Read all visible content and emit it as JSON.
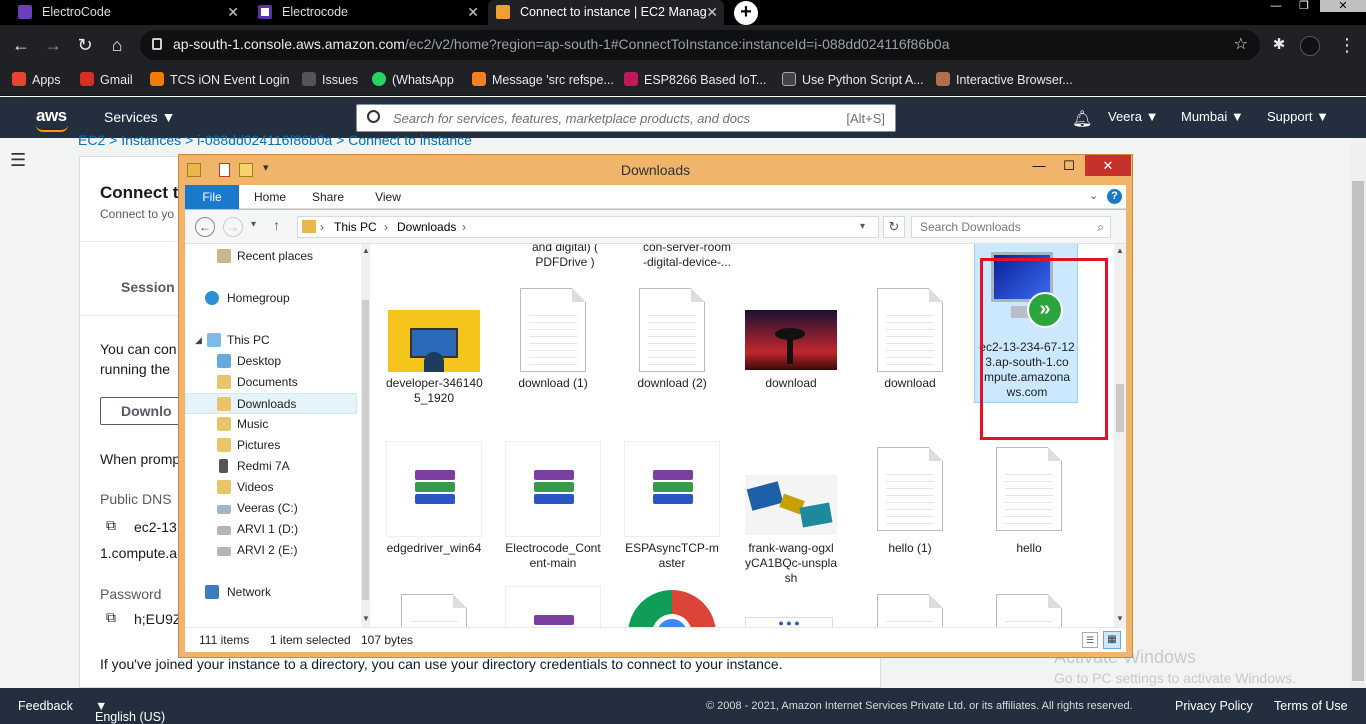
{
  "browser": {
    "tabs": [
      {
        "title": "ElectroCode",
        "color": "#6c3fbf"
      },
      {
        "title": "Electrocode",
        "color": "#ffffff"
      },
      {
        "title": "Connect to instance | EC2 Manag",
        "color": "#f0a030",
        "active": true
      }
    ],
    "new_tab": "+",
    "url_host": "ap-south-1.console.aws.amazon.com",
    "url_path": "/ec2/v2/home?region=ap-south-1#ConnectToInstance:instanceId=i-088dd024116f86b0a",
    "bookmarks": [
      {
        "label": "Apps",
        "color": "#ea4335"
      },
      {
        "label": "Gmail",
        "color": "#d93025"
      },
      {
        "label": "TCS iON Event Login",
        "color": "#f57c00"
      },
      {
        "label": "Issues",
        "color": "#555555"
      },
      {
        "label": "(WhatsApp",
        "color": "#25d366"
      },
      {
        "label": "Message 'src refspe...",
        "color": "#f48024"
      },
      {
        "label": "ESP8266 Based IoT...",
        "color": "#c2185b"
      },
      {
        "label": "Use Python Script A...",
        "color": "#444444"
      },
      {
        "label": "Interactive Browser...",
        "color": "#b07050"
      }
    ]
  },
  "aws": {
    "logo": "aws",
    "services": "Services",
    "search_placeholder": "Search for services, features, marketplace products, and docs",
    "search_shortcut": "[Alt+S]",
    "user": "Veera",
    "region": "Mumbai",
    "support": "Support",
    "breadcrumb": "EC2   >   Instances   >   i-088dd024116f86b0a   >   Connect to instance",
    "page_title": "Connect t",
    "page_subtitle": "Connect to yo",
    "session_label": "Session M",
    "body_line1": "You can con",
    "body_line2": "running the",
    "download_btn": "Downlo",
    "when_prompt": "When promp",
    "public_dns_label": "Public DNS",
    "public_dns_value1": "ec2-13",
    "public_dns_value2": "1.compute.a",
    "password_label": "Password",
    "password_value": "h;EU9Z",
    "joined_text": "If you've joined your instance to a directory, you can use your directory credentials to connect to your instance.",
    "watermark_title": "Activate Windows",
    "watermark_sub": "Go to PC settings to activate Windows.",
    "footer": {
      "feedback": "Feedback",
      "language": "English (US)",
      "copyright": "© 2008 - 2021, Amazon Internet Services Private Ltd. or its affiliates. All rights reserved.",
      "privacy": "Privacy Policy",
      "terms": "Terms of Use"
    }
  },
  "explorer": {
    "title": "Downloads",
    "ribbon_tabs": [
      "File",
      "Home",
      "Share",
      "View"
    ],
    "address": [
      "This PC",
      "Downloads"
    ],
    "search_placeholder": "Search Downloads",
    "nav": {
      "recent": "Recent places",
      "homegroup": "Homegroup",
      "thispc": "This PC",
      "desktop": "Desktop",
      "documents": "Documents",
      "downloads": "Downloads",
      "music": "Music",
      "pictures": "Pictures",
      "redmi": "Redmi 7A",
      "videos": "Videos",
      "veeras": "Veeras (C:)",
      "arvi1": "ARVI 1 (D:)",
      "arvi2": "ARVI 2 (E:)",
      "network": "Network"
    },
    "top_labels": {
      "a": "and digital) (\nPDFDrive )",
      "b": "con-server-room\n-digital-device-..."
    },
    "row1": [
      {
        "label": "developer-346140\n5_1920",
        "kind": "image"
      },
      {
        "label": "download (1)",
        "kind": "doc"
      },
      {
        "label": "download (2)",
        "kind": "doc"
      },
      {
        "label": "download",
        "kind": "photo"
      },
      {
        "label": "download",
        "kind": "doc"
      },
      {
        "label": "ec2-13-234-67-12\n3.ap-south-1.co\nmpute.amazona\nws.com",
        "kind": "rdp"
      }
    ],
    "row2": [
      {
        "label": "edgedriver_win64",
        "kind": "rar"
      },
      {
        "label": "Electrocode_Cont\nent-main",
        "kind": "rar"
      },
      {
        "label": "ESPAsyncTCP-m\naster",
        "kind": "rar"
      },
      {
        "label": "frank-wang-ogxl\nyCA1BQc-unspla\nsh",
        "kind": "board"
      },
      {
        "label": "hello (1)",
        "kind": "doc"
      },
      {
        "label": "hello",
        "kind": "doc"
      }
    ],
    "status": {
      "count": "111 items",
      "selected": "1 item selected",
      "size": "107 bytes"
    }
  }
}
